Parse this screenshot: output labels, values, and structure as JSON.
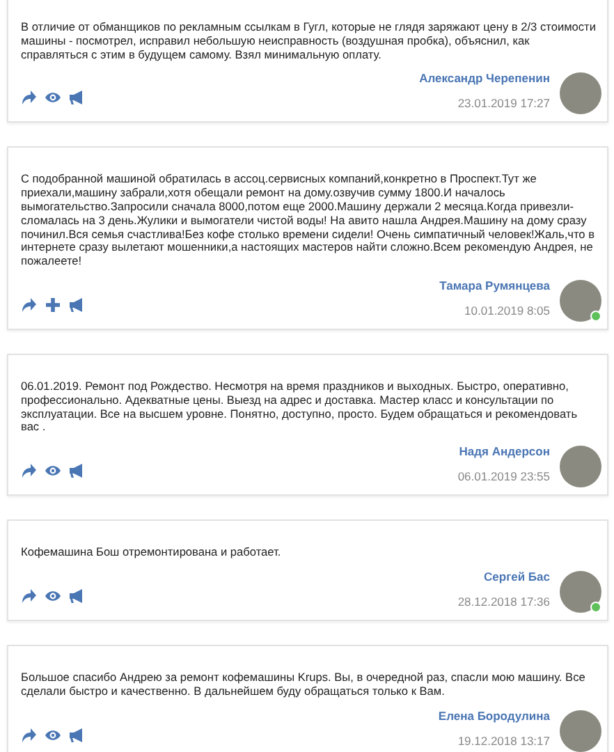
{
  "reviews": [
    {
      "text": "В отличие от обманщиков по рекламным ссылкам в Гугл, которые не глядя заряжают цену в 2/3 стоимости машины - посмотрел, исправил небольшую неисправность (воздушная пробка), объяснил, как справляться с этим в будущем самому. Взял минимальную оплату.",
      "author": "Александр Черепенин",
      "date": "23.01.2019 17:27",
      "online": false,
      "actions": [
        {
          "kind": "share"
        },
        {
          "kind": "eye"
        },
        {
          "kind": "megaphone"
        }
      ]
    },
    {
      "text": "С подобранной машиной обратилась в ассоц.сервисных компаний,конкретно в Проспект.Тут же приехали,машину забрали,хотя обещали ремонт на дому.озвучив сумму 1800.И началось вымогательство.Запросили сначала 8000,потом еще 2000.Машину держали 2 месяца.Когда привезли-сломалась на 3 день.Жулики и вымогатели чистой воды! На авито нашла Андрея.Машину на дому сразу починил.Вся семья счастлива!Без кофе столько времени сидели! Очень симпатичный человек!Жаль,что в интернете сразу вылетают мошенники,а настоящих мастеров найти сложно.Всем рекомендую Андрея, не пожалеете!",
      "author": "Тамара Румянцева",
      "date": "10.01.2019 8:05",
      "online": true,
      "actions": [
        {
          "kind": "share"
        },
        {
          "kind": "plus"
        },
        {
          "kind": "megaphone"
        }
      ]
    },
    {
      "text": "06.01.2019. Ремонт под Рождество. Несмотря на время праздников и выходных. Быстро, оперативно, профессионально. Адекватные цены. Выезд на адрес и доставка. Мастер класс и консультации по эксплуатации. Все на высшем уровне. Понятно, доступно, просто. Будем обращаться и рекомендовать вас .",
      "author": "Надя Андерсон",
      "date": "06.01.2019 23:55",
      "online": false,
      "actions": [
        {
          "kind": "share"
        },
        {
          "kind": "eye"
        },
        {
          "kind": "megaphone"
        }
      ]
    },
    {
      "text": "Кофемашина Бош отремонтирована и работает.",
      "author": "Сергей Бас",
      "date": "28.12.2018 17:36",
      "online": true,
      "actions": [
        {
          "kind": "share"
        },
        {
          "kind": "eye"
        },
        {
          "kind": "megaphone"
        }
      ]
    },
    {
      "text": "Большое спасибо Андрею за ремонт кофемашины Krups. Вы, в очередной раз, спасли мою машину. Все сделали быстро и качественно. В дальнейшем буду обращаться только к Вам.",
      "author": "Елена Бородулина",
      "date": "19.12.2018 13:17",
      "online": false,
      "actions": [
        {
          "kind": "share"
        },
        {
          "kind": "eye"
        },
        {
          "kind": "megaphone"
        }
      ]
    }
  ]
}
